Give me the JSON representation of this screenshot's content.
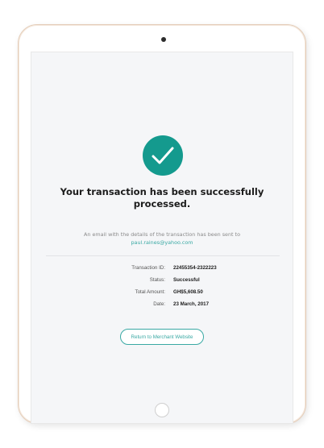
{
  "colors": {
    "accent": "#3aa9a4",
    "check_circle": "#149a8e",
    "screen_background": "#f5f6f8",
    "device_bezel": "#e4cdb9"
  },
  "icons": {
    "success": "checkmark-icon"
  },
  "confirmation": {
    "title": "Your transaction has been successfully processed.",
    "email_note": "An email with the details of the transaction has been sent to",
    "email": "paul.raines@yahoo.com"
  },
  "details": [
    {
      "label": "Transaction ID:",
      "value": "22455354-2322223"
    },
    {
      "label": "Status:",
      "value": "Successful"
    },
    {
      "label": "Total Amount:",
      "value": "GH$5,608.50"
    },
    {
      "label": "Date:",
      "value": "23 March, 2017"
    }
  ],
  "actions": {
    "return_label": "Return to Merchant Website"
  }
}
